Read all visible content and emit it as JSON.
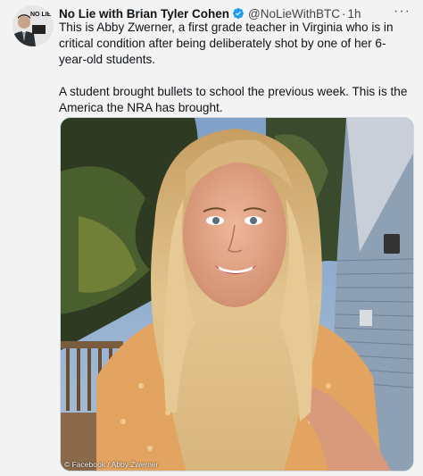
{
  "tweet": {
    "author_name": "No Lie with Brian Tyler Cohen",
    "handle": "@NoLieWithBTC",
    "separator": "·",
    "time": "1h",
    "more_label": "···",
    "verified_icon": "verified-badge-icon",
    "avatar_text": "NO LIE",
    "body_paragraphs": [
      "This is Abby Zwerner, a first grade teacher in Virginia who is in critical condition after being deliberately shot by one of her 6-year-old students.",
      "A student brought bullets to school the previous week. This is the America the NRA has brought."
    ],
    "photo_credit": "© Facebook / Abby Zwerner"
  },
  "colors": {
    "verified_blue": "#1d9bf0",
    "text": "#0f1419",
    "secondary_text": "#536471"
  }
}
